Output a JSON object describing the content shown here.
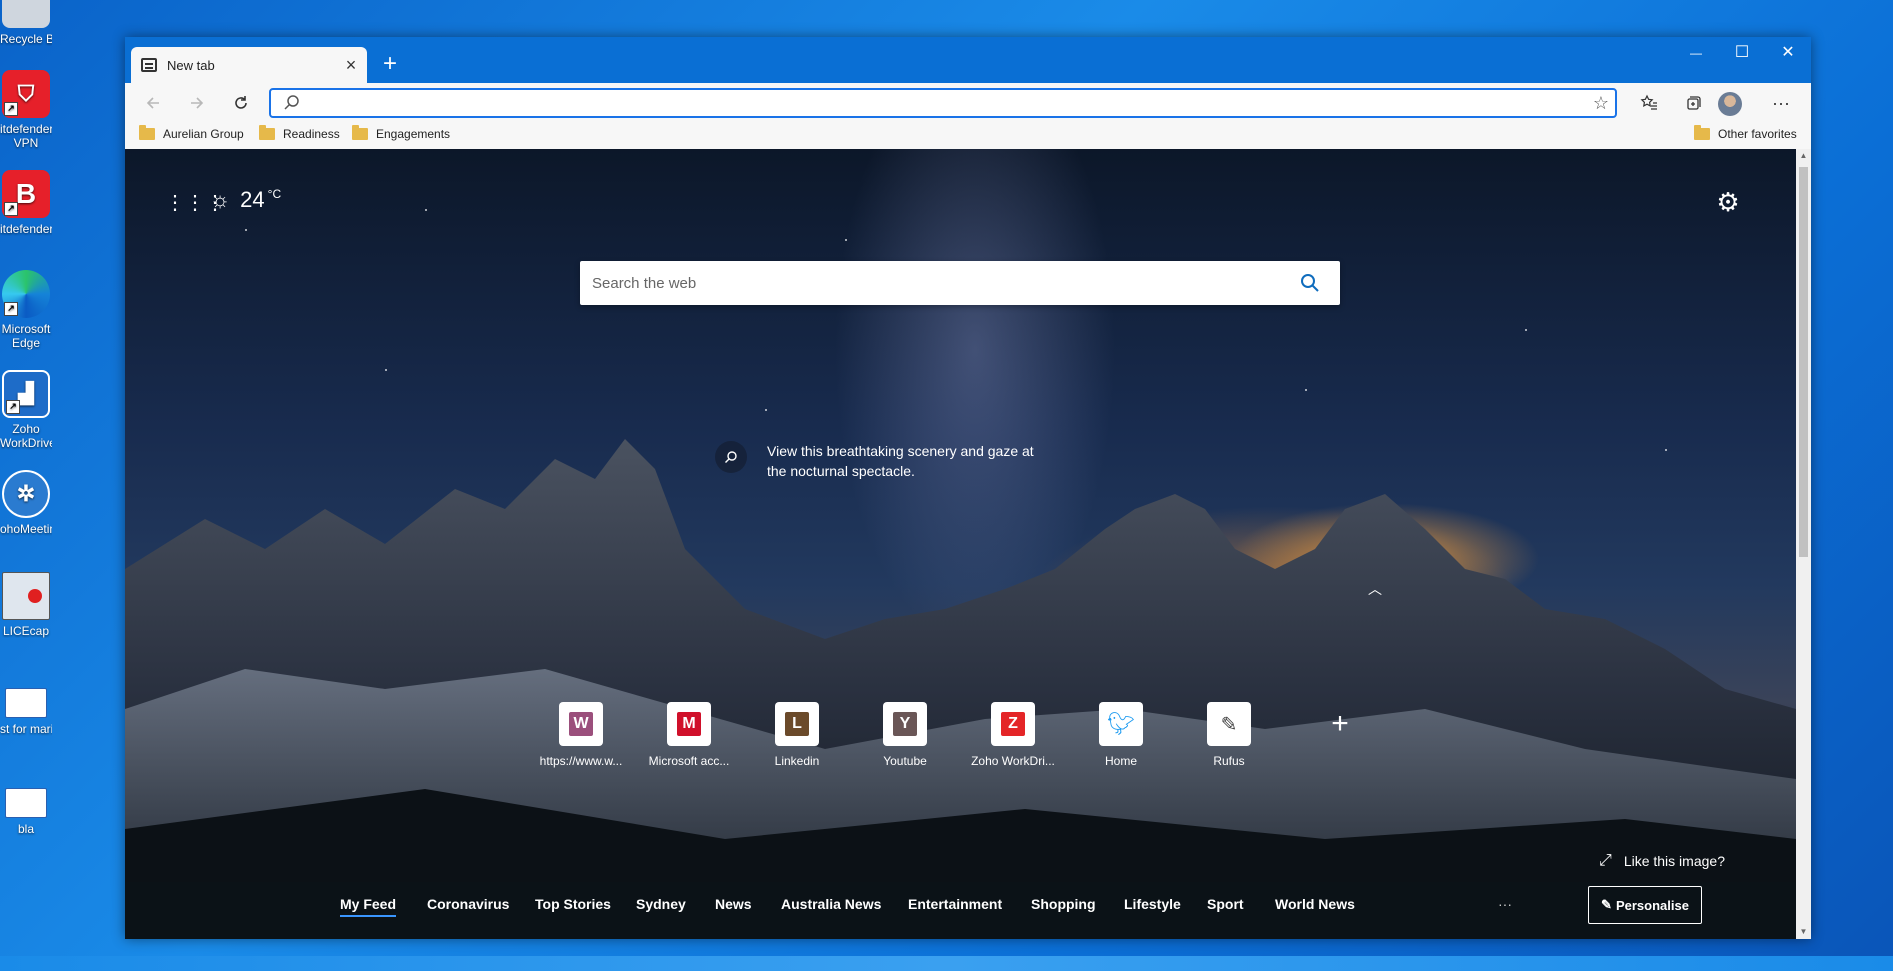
{
  "desktop": {
    "icons": [
      {
        "label": "Recycle Bin",
        "icon": "recycle-bin-icon"
      },
      {
        "label": "Bitdefender VPN",
        "line1": "itdefender",
        "line2": "VPN",
        "icon": "bitdefender-vpn-icon"
      },
      {
        "label": "itdefender",
        "icon": "bitdefender-icon",
        "glyph": "B"
      },
      {
        "label": "Microsoft Edge",
        "line1": "Microsoft",
        "line2": "Edge",
        "icon": "edge-icon"
      },
      {
        "label": "Zoho WorkDriveTS",
        "line1": "Zoho",
        "line2": "WorkDriveTS",
        "icon": "zoho-workdrive-icon"
      },
      {
        "label": "ohoMeeting",
        "icon": "zoho-meeting-icon"
      },
      {
        "label": "LICEcap",
        "icon": "licecap-icon"
      },
      {
        "label": "st for mario",
        "icon": "document-icon"
      },
      {
        "label": "bla",
        "icon": "document-icon"
      }
    ]
  },
  "browser": {
    "tab": {
      "title": "New tab",
      "close": "×"
    },
    "new_tab": "+",
    "window_controls": {
      "minimize": "—",
      "maximize": "☐",
      "close": "✕"
    },
    "address": {
      "value": "",
      "placeholder": ""
    },
    "favorites": [
      {
        "label": "Aurelian Group"
      },
      {
        "label": "Readiness"
      },
      {
        "label": "Engagements"
      }
    ],
    "other_favorites": "Other favorites"
  },
  "newtab": {
    "weather": {
      "temp": "24",
      "unit": "°C",
      "icon": "sun-icon"
    },
    "search": {
      "placeholder": "Search the web"
    },
    "caption": "View this breathtaking scenery and gaze at the nocturnal spectacle.",
    "tiles": [
      {
        "label": "https://www.w...",
        "letter": "W",
        "color": "#9b4f7c"
      },
      {
        "label": "Microsoft acc...",
        "letter": "M",
        "color": "#d0102a"
      },
      {
        "label": "Linkedin",
        "letter": "L",
        "color": "#6b4a2a"
      },
      {
        "label": "Youtube",
        "letter": "Y",
        "color": "#6a5656"
      },
      {
        "label": "Zoho WorkDri...",
        "letter": "Z",
        "color": "#e42527"
      },
      {
        "label": "Home",
        "letter": "",
        "icon": "twitter-bird-icon",
        "color": "#1d9bf0"
      },
      {
        "label": "Rufus",
        "letter": "",
        "icon": "usb-drive-icon",
        "color": "#444444"
      }
    ],
    "like_image": "Like this image?",
    "feed_tabs": [
      "My Feed",
      "Coronavirus",
      "Top Stories",
      "Sydney",
      "News",
      "Australia News",
      "Entertainment",
      "Shopping",
      "Lifestyle",
      "Sport",
      "World News"
    ],
    "feed_more": "···",
    "personalise": "Personalise"
  },
  "colors": {
    "accent": "#1a73e8",
    "titlebar": "#0a6fd4",
    "desktop": "#1a8be8"
  }
}
